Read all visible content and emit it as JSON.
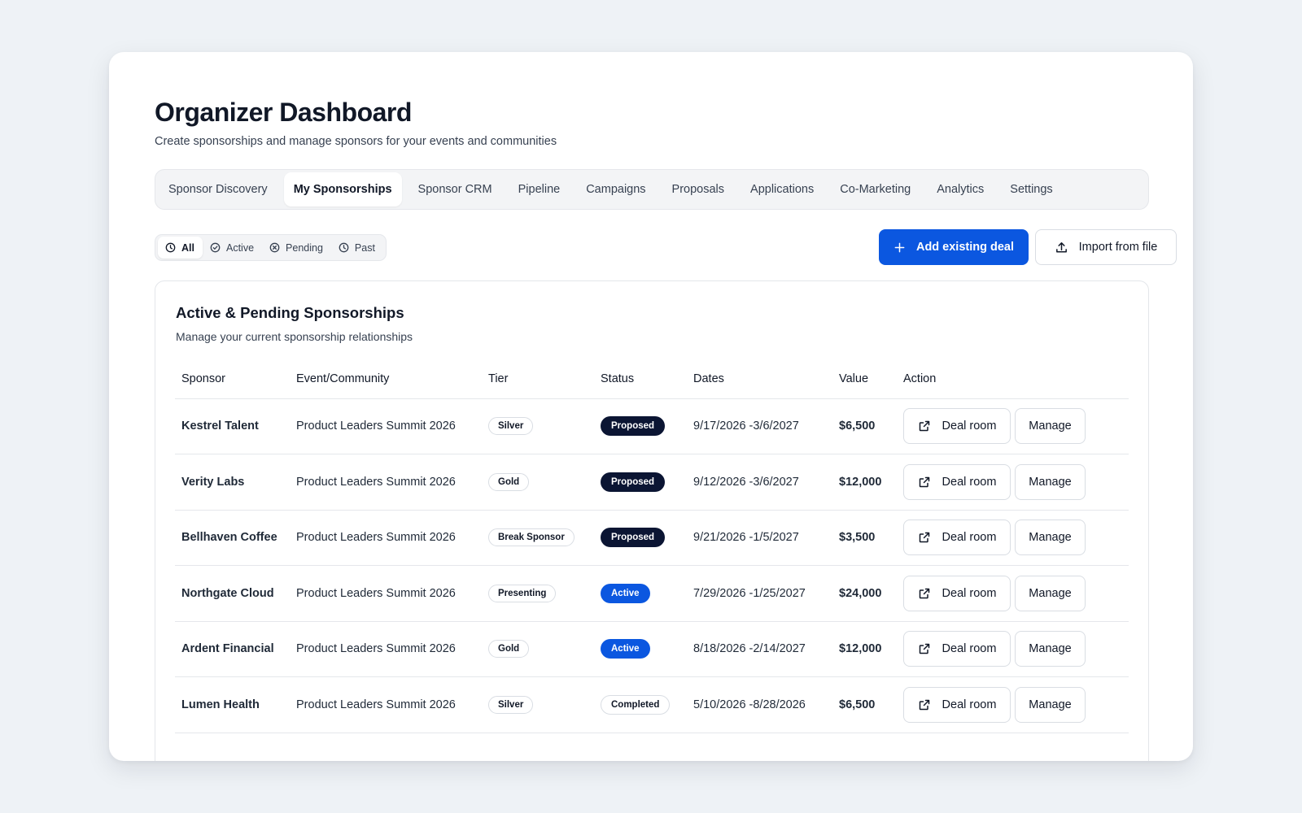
{
  "header": {
    "title": "Organizer Dashboard",
    "subtitle": "Create sponsorships and manage sponsors for your events and communities"
  },
  "tabs": [
    {
      "label": "Sponsor Discovery",
      "active": false
    },
    {
      "label": "My Sponsorships",
      "active": true
    },
    {
      "label": "Sponsor CRM",
      "active": false
    },
    {
      "label": "Pipeline",
      "active": false
    },
    {
      "label": "Campaigns",
      "active": false
    },
    {
      "label": "Proposals",
      "active": false
    },
    {
      "label": "Applications",
      "active": false
    },
    {
      "label": "Co-Marketing",
      "active": false
    },
    {
      "label": "Analytics",
      "active": false
    },
    {
      "label": "Settings",
      "active": false
    }
  ],
  "filters": [
    {
      "label": "All",
      "icon": "clock-icon",
      "active": true
    },
    {
      "label": "Active",
      "icon": "check-circle-icon",
      "active": false
    },
    {
      "label": "Pending",
      "icon": "x-circle-icon",
      "active": false
    },
    {
      "label": "Past",
      "icon": "clock-icon",
      "active": false
    }
  ],
  "actions": {
    "add_deal_label": "Add existing deal",
    "import_label": "Import from file"
  },
  "panel": {
    "title": "Active & Pending Sponsorships",
    "subtitle": "Manage your current sponsorship relationships",
    "columns": [
      "Sponsor",
      "Event/Community",
      "Tier",
      "Status",
      "Dates",
      "Value",
      "Action"
    ],
    "deal_room_label": "Deal room",
    "manage_label": "Manage",
    "rows": [
      {
        "sponsor": "Kestrel Talent",
        "event": "Product Leaders Summit 2026",
        "tier": "Silver",
        "status": "Proposed",
        "dates": "9/17/2026 -3/6/2027",
        "value": "$6,500"
      },
      {
        "sponsor": "Verity Labs",
        "event": "Product Leaders Summit 2026",
        "tier": "Gold",
        "status": "Proposed",
        "dates": "9/12/2026 -3/6/2027",
        "value": "$12,000"
      },
      {
        "sponsor": "Bellhaven Coffee",
        "event": "Product Leaders Summit 2026",
        "tier": "Break Sponsor",
        "status": "Proposed",
        "dates": "9/21/2026 -1/5/2027",
        "value": "$3,500"
      },
      {
        "sponsor": "Northgate Cloud",
        "event": "Product Leaders Summit 2026",
        "tier": "Presenting",
        "status": "Active",
        "dates": "7/29/2026 -1/25/2027",
        "value": "$24,000"
      },
      {
        "sponsor": "Ardent Financial",
        "event": "Product Leaders Summit 2026",
        "tier": "Gold",
        "status": "Active",
        "dates": "8/18/2026 -2/14/2027",
        "value": "$12,000"
      },
      {
        "sponsor": "Lumen Health",
        "event": "Product Leaders Summit 2026",
        "tier": "Silver",
        "status": "Completed",
        "dates": "5/10/2026 -8/28/2026",
        "value": "$6,500"
      }
    ]
  },
  "colors": {
    "primary": "#0b57e0",
    "status_proposed": "#0b1533",
    "status_active": "#0b57e0",
    "status_completed_border": "#d9dde3"
  }
}
